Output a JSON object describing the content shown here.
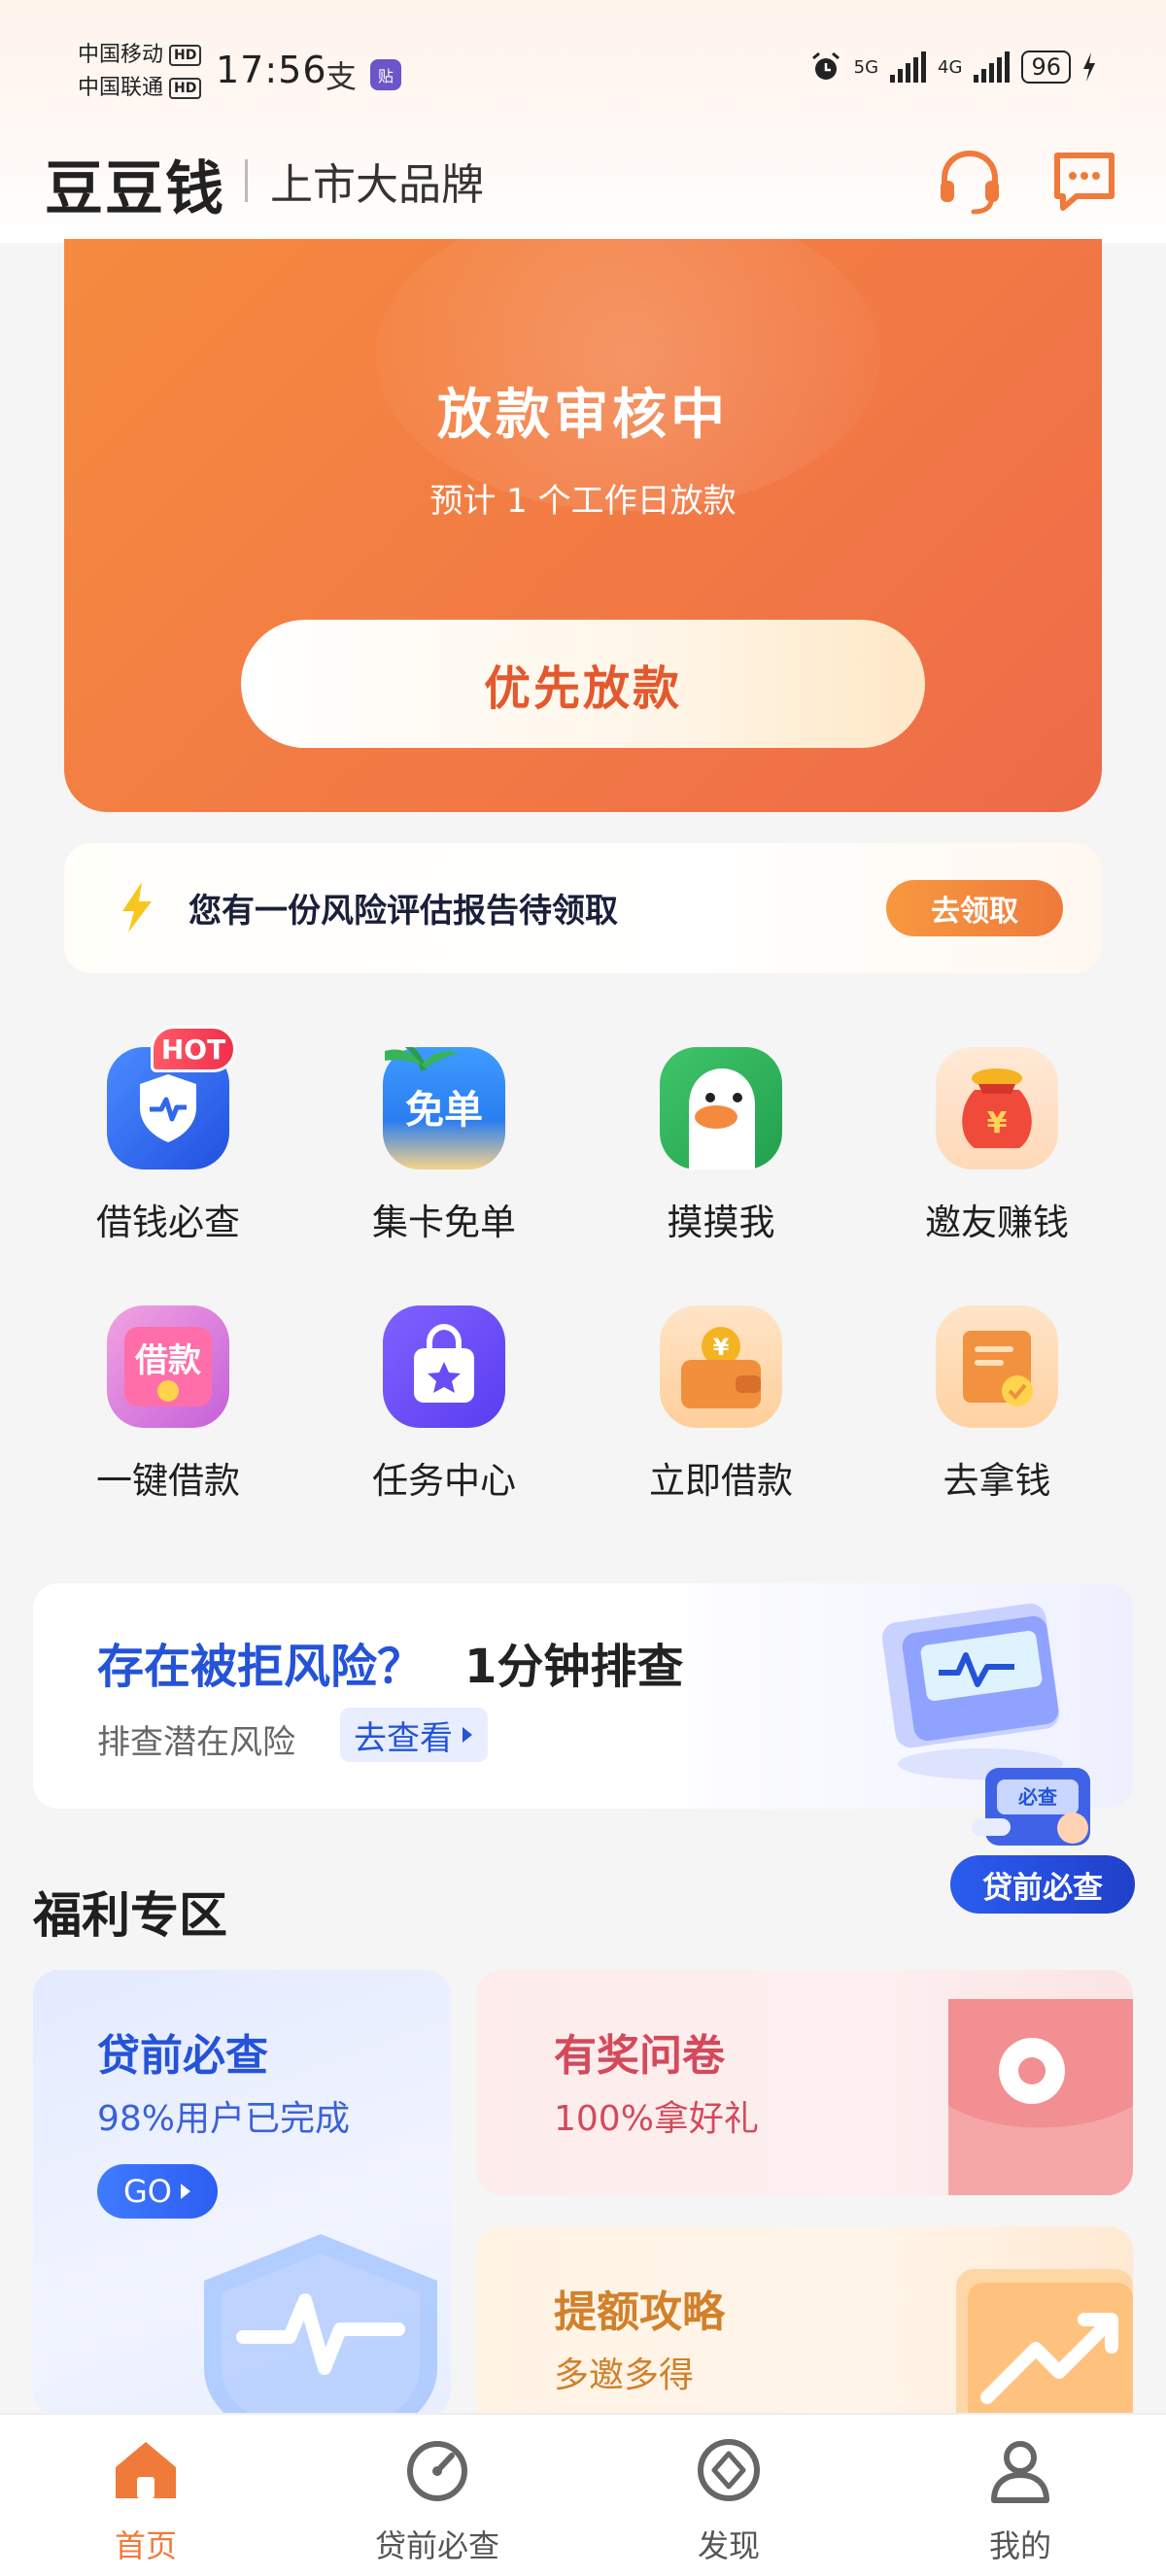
{
  "status_bar": {
    "carrier1": "中国移动",
    "carrier2": "中国联通",
    "hd": "HD",
    "time": "17:56",
    "net1": "5G",
    "net2": "4G",
    "battery": "96"
  },
  "header": {
    "brand": "豆豆钱",
    "slogan": "上市大品牌"
  },
  "hero": {
    "title": "放款审核中",
    "subtitle": "预计 1 个工作日放款",
    "button": "优先放款"
  },
  "report_banner": {
    "text": "您有一份风险评估报告待领取",
    "button": "去领取"
  },
  "grid": [
    {
      "label": "借钱必查",
      "badge": "HOT",
      "icon": "shield-pulse-icon"
    },
    {
      "label": "集卡免单",
      "badge_text": "免单",
      "icon": "free-order-icon"
    },
    {
      "label": "摸摸我",
      "icon": "duck-icon"
    },
    {
      "label": "邀友赚钱",
      "icon": "money-bag-icon"
    },
    {
      "label": "一键借款",
      "badge_text": "借款",
      "icon": "loan-envelope-icon"
    },
    {
      "label": "任务中心",
      "icon": "task-bag-icon"
    },
    {
      "label": "立即借款",
      "icon": "wallet-icon"
    },
    {
      "label": "去拿钱",
      "icon": "scroll-check-icon"
    }
  ],
  "risk_banner": {
    "title_blue": "存在被拒风险？",
    "title_dark": "1分钟排查",
    "subtitle": "排查潜在风险",
    "link": "去查看",
    "float_badge": "贷前必查",
    "float_badge_small": "必查"
  },
  "welfare": {
    "section_title": "福利专区",
    "card_blue": {
      "title": "贷前必查",
      "subtitle": "98%用户已完成",
      "go": "GO"
    },
    "card_pink": {
      "title": "有奖问卷",
      "subtitle": "100%拿好礼"
    },
    "card_orange": {
      "title": "提额攻略",
      "subtitle": "多邀多得"
    }
  },
  "bottom_nav": [
    {
      "label": "首页",
      "active": true
    },
    {
      "label": "贷前必查",
      "active": false
    },
    {
      "label": "发现",
      "active": false
    },
    {
      "label": "我的",
      "active": false
    }
  ],
  "colors": {
    "accent_orange": "#f07a3a",
    "accent_blue": "#2453d8",
    "hero_gradient_start": "#f58a3e",
    "hero_gradient_end": "#ee6a48"
  }
}
